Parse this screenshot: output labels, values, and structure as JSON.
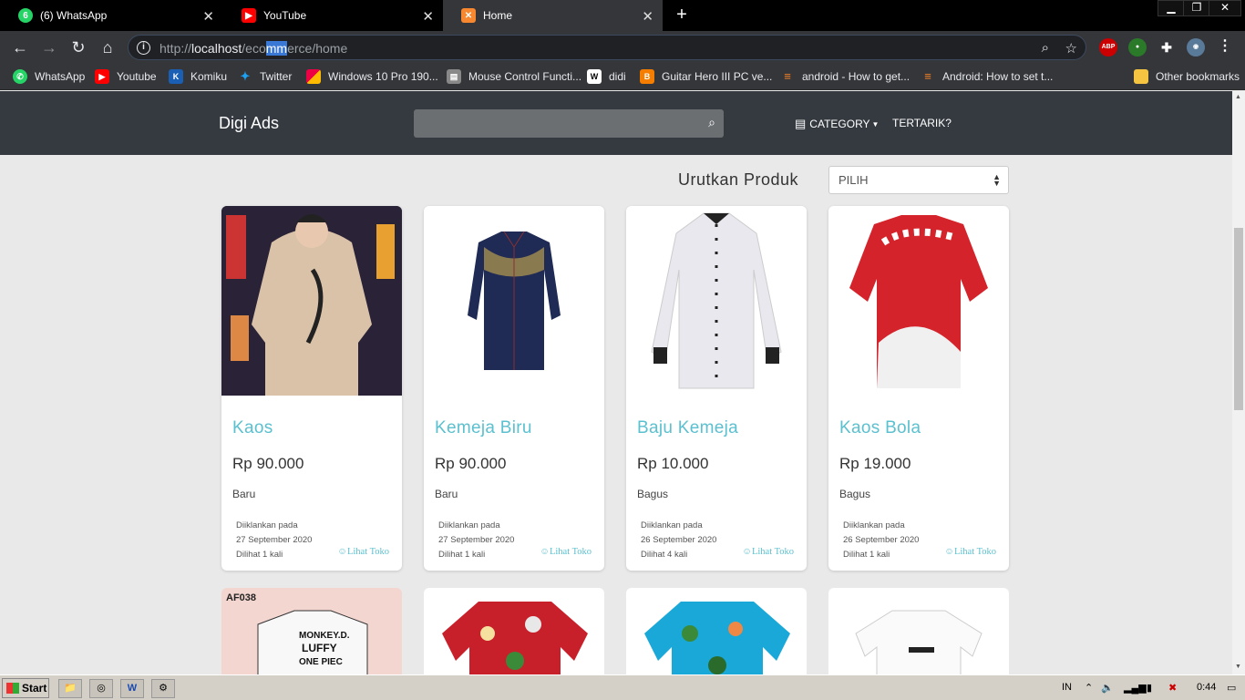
{
  "browser": {
    "tabs": [
      {
        "title": "(6) WhatsApp",
        "badge": "6"
      },
      {
        "title": "YouTube"
      },
      {
        "title": "Home",
        "active": true
      }
    ],
    "url": {
      "scheme": "http://",
      "host": "localhost",
      "path_a": "/eco",
      "path_sel": "mm",
      "path_b": "erce/home"
    },
    "bookmarks": [
      {
        "label": "WhatsApp",
        "icon": "whatsapp-icon"
      },
      {
        "label": "Youtube",
        "icon": "youtube-icon"
      },
      {
        "label": "Komiku",
        "icon": "komiku-icon"
      },
      {
        "label": "Twitter",
        "icon": "twitter-icon"
      },
      {
        "label": "Windows 10 Pro 190...",
        "icon": "windows-icon"
      },
      {
        "label": "Mouse Control Functi...",
        "icon": "page-icon"
      },
      {
        "label": "didi",
        "icon": "wikipedia-icon"
      },
      {
        "label": "Guitar Hero III PC ve...",
        "icon": "blogger-icon"
      },
      {
        "label": "android - How to get...",
        "icon": "stackoverflow-icon"
      },
      {
        "label": "Android: How to set t...",
        "icon": "stackoverflow-icon"
      },
      {
        "label": "Other bookmarks",
        "icon": "folder-icon"
      }
    ],
    "extensions": {
      "abp": "ABP"
    }
  },
  "site": {
    "brand": "Digi Ads",
    "search_placeholder": "",
    "nav": {
      "category": "CATEGORY",
      "tertarik": "TERTARIK?"
    },
    "sort": {
      "label": "Urutkan Produk",
      "selected": "PILIH"
    }
  },
  "products": [
    {
      "title": "Kaos",
      "price": "Rp 90.000",
      "condition": "Baru",
      "posted_label": "Diiklankan pada",
      "posted_date": "27 September 2020",
      "views": "Dilihat 1 kali",
      "link": "Lihat Toko"
    },
    {
      "title": "Kemeja Biru",
      "price": "Rp 90.000",
      "condition": "Baru",
      "posted_label": "Diiklankan pada",
      "posted_date": "27 September 2020",
      "views": "Dilihat 1 kali",
      "link": "Lihat Toko"
    },
    {
      "title": "Baju Kemeja",
      "price": "Rp 10.000",
      "condition": "Bagus",
      "posted_label": "Diiklankan pada",
      "posted_date": "26 September 2020",
      "views": "Dilihat 4 kali",
      "link": "Lihat Toko"
    },
    {
      "title": "Kaos Bola",
      "price": "Rp 19.000",
      "condition": "Bagus",
      "posted_label": "Diiklankan pada",
      "posted_date": "26 September 2020",
      "views": "Dilihat 1 kali",
      "link": "Lihat Toko"
    }
  ],
  "second_row": {
    "first_tag": "AF038"
  },
  "taskbar": {
    "start": "Start",
    "lang": "IN",
    "clock": "0:44"
  },
  "colors": {
    "navbar": "#343a40",
    "accent": "#5bc0cf",
    "page_bg": "#e9e9e9"
  }
}
